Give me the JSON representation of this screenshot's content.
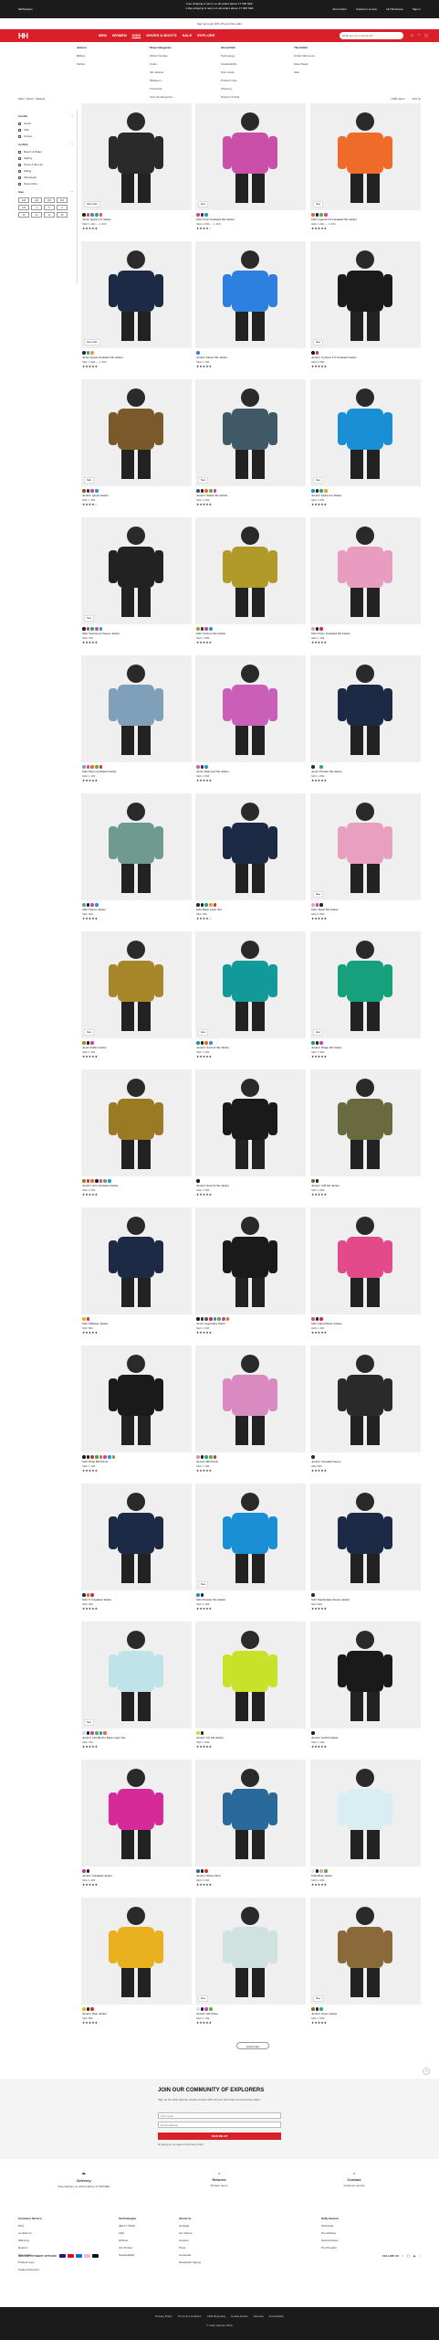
{
  "topbar": {
    "promo1": "Free shipping & return on all orders above 17 000 SEK",
    "promo2": "1-Day shipping & return on all orders above 17 000 SEK",
    "location": "SE/Sweden",
    "links": [
      "Store finder",
      "Customer service",
      "HH Workwear",
      "Sign in"
    ]
  },
  "promo_bar": "Sign up & get 10% off your first order",
  "nav": {
    "logo": "HH",
    "links": [
      "MEN",
      "WOMEN",
      "KIDS",
      "SHOES & BOOTS",
      "SALE",
      "EXPLORE"
    ],
    "active": "KIDS",
    "search_placeholder": "What are you looking for?",
    "icons": [
      "user-icon",
      "heart-icon",
      "bag-icon"
    ]
  },
  "mega": {
    "col1": [
      "Juniors",
      "Babies",
      "Mother"
    ],
    "col2": [
      "Shop Categories",
      "Winter Clothes",
      "Coats",
      "Ski Jackets",
      "Midlayers",
      "Snowsuits",
      "View all categories"
    ],
    "col3": [
      "About Kids",
      "Technology",
      "Sustainability",
      "Size Guide",
      "Product Care",
      "Shipping",
      "Support & FAQ"
    ],
    "col4": [
      "The Outlet",
      "Outlet Kids Items",
      "Shop Deals",
      "Sale"
    ]
  },
  "breadcrumb": "Kids / Junior / Jackets",
  "sort": {
    "count": "(108) Items",
    "label": "Sort by"
  },
  "filters": {
    "gender_title": "Gender",
    "genders": [
      "Junior",
      "Kids",
      "Unisex"
    ],
    "activity_title": "Activity",
    "activities": [
      "Beach & Water",
      "Sailing",
      "Snow & Ski Life",
      "Hiking",
      "Sleepwear",
      "Show More"
    ],
    "size_title": "Size",
    "sizes": [
      "128",
      "140",
      "152",
      "164",
      "176",
      "4",
      "6",
      "8",
      "10",
      "12",
      "14",
      "16"
    ]
  },
  "product_card": {
    "badge": "New"
  },
  "products": [
    {
      "name": "Junior Quest 2.0 Jacket",
      "price": "SEK 1 420 — 1 500",
      "stars": "★★★★★",
      "badge": "New Color",
      "img": "#2a2a2a",
      "sw": [
        "#222",
        "#c53",
        "#67c",
        "#2a8",
        "#d4a"
      ]
    },
    {
      "name": "Kids' Frost Insulated Ski Jacket",
      "price": "SEK 1 099 — 1 499",
      "stars": "★★★★☆",
      "badge": "New",
      "img": "#c94fa8",
      "sw": [
        "#c4a",
        "#333",
        "#29c"
      ]
    },
    {
      "name": "Kids' Legend 2.0 Insulated Ski Jacket",
      "price": "SEK 1 260 — 1 600",
      "stars": "★★★★★",
      "badge": "New",
      "img": "#ef6b2a",
      "sw": [
        "#e62",
        "#222",
        "#6a4",
        "#c4a"
      ]
    },
    {
      "name": "Junior Quest Insulated Ski Jacket",
      "price": "SEK 1 099 — 1 899",
      "stars": "★★★★★",
      "badge": "New Color",
      "img": "#1c2a45",
      "sw": [
        "#1c2a45",
        "#2a7",
        "#e93"
      ]
    },
    {
      "name": "Juniors' Alpine Ski Jacket",
      "price": "SEK 1 799",
      "stars": "★★★★★",
      "badge": "",
      "img": "#2d7fe0",
      "sw": [
        "#2d7fe0"
      ]
    },
    {
      "name": "Juniors' Cyclone 2.0 Insulated Jacket",
      "price": "SEK 2 999",
      "stars": "★★★★★",
      "badge": "New",
      "img": "#1a1a1a",
      "sw": [
        "#1a1a1a",
        "#c33",
        "#fff"
      ]
    },
    {
      "name": "Juniors' Quest Jacket",
      "price": "SEK 1 399",
      "stars": "★★★★☆",
      "badge": "Sale",
      "img": "#7a5a2a",
      "sw": [
        "#7a5a2a",
        "#333",
        "#c4a",
        "#29c"
      ]
    },
    {
      "name": "Juniors' Stellar Ski Jacket",
      "price": "SEK 1 699",
      "stars": "★★★★★",
      "badge": "New",
      "img": "#3f5a66",
      "sw": [
        "#3f5a66",
        "#222",
        "#e62",
        "#6a4",
        "#c4a"
      ]
    },
    {
      "name": "Juniors' Alpha 3.0 Jacket",
      "price": "SEK 2 499",
      "stars": "★★★★★",
      "badge": "New",
      "img": "#1a8fd6",
      "sw": [
        "#1a8fd6",
        "#222",
        "#2a7",
        "#e93"
      ]
    },
    {
      "name": "Kids' Vancouver Fleece Jacket",
      "price": "SEK 799",
      "stars": "★★★★★",
      "badge": "New",
      "img": "#222222",
      "sw": [
        "#222",
        "#c44",
        "#2a7",
        "#d4a",
        "#29c"
      ]
    },
    {
      "name": "Kids' Venture Ski Jacket",
      "price": "SEK 1 899",
      "stars": "★★★★★",
      "badge": "",
      "img": "#b29a2a",
      "sw": [
        "#b29a2a",
        "#333",
        "#c4a",
        "#29c"
      ]
    },
    {
      "name": "Kids' Flurry Insulated Ski Jacket",
      "price": "SEK 1 499",
      "stars": "★★★★★",
      "badge": "",
      "img": "#e89cc0",
      "sw": [
        "#e89cc0",
        "#222",
        "#c33"
      ]
    },
    {
      "name": "Kids' Moon Insulated Jacket",
      "price": "SEK 1 199",
      "stars": "★★★★★",
      "badge": "",
      "img": "#7fa0b8",
      "sw": [
        "#7fa0b8",
        "#c4a",
        "#e62",
        "#6a4",
        "#c33"
      ]
    },
    {
      "name": "Junior Diamond Ski Jacket",
      "price": "SEK 2 099",
      "stars": "★★★★★",
      "badge": "",
      "img": "#c95fb8",
      "sw": [
        "#c95fb8",
        "#333",
        "#29c"
      ]
    },
    {
      "name": "Junior Powder Ski Jacket",
      "price": "SEK 1 699",
      "stars": "★★★★★",
      "badge": "",
      "img": "#1c2a45",
      "sw": [
        "#1c2a45",
        "#fff",
        "#2a7"
      ]
    },
    {
      "name": "Kids' Fleece Jacket",
      "price": "SEK 699",
      "stars": "★★★★★",
      "badge": "",
      "img": "#6f9a90",
      "sw": [
        "#6f9a90",
        "#222",
        "#c4a",
        "#29c"
      ]
    },
    {
      "name": "Kids' Base Layer Set",
      "price": "SEK 599",
      "stars": "★★★★☆",
      "badge": "",
      "img": "#1c2a45",
      "sw": [
        "#1c2a45",
        "#222",
        "#2a7",
        "#e93",
        "#c33"
      ]
    },
    {
      "name": "Kids' Jewel Ski Jacket",
      "price": "SEK 1 899",
      "stars": "★★★★★",
      "badge": "New",
      "img": "#e8a0c0",
      "sw": [
        "#e8a0c0",
        "#c4a",
        "#222"
      ]
    },
    {
      "name": "Junior Puffer Jacket",
      "price": "SEK 1 499",
      "stars": "★★★★★",
      "badge": "New",
      "img": "#a8862a",
      "sw": [
        "#a8862a",
        "#222",
        "#c4a"
      ]
    },
    {
      "name": "Juniors' Summit Ski Jacket",
      "price": "SEK 1 999",
      "stars": "★★★★★",
      "badge": "New",
      "img": "#129a9a",
      "sw": [
        "#129a9a",
        "#222",
        "#e62",
        "#29c"
      ]
    },
    {
      "name": "Juniors' Ridge Ski Jacket",
      "price": "SEK 1 999",
      "stars": "★★★★★",
      "badge": "New",
      "img": "#16a07c",
      "sw": [
        "#16a07c",
        "#222",
        "#c4a"
      ]
    },
    {
      "name": "Juniors' Icon Insulated Jacket",
      "price": "SEK 2 299",
      "stars": "★★★★★",
      "badge": "",
      "img": "#9a7a22",
      "sw": [
        "#9a7a22",
        "#c33",
        "#e62",
        "#222",
        "#c4a",
        "#6a4",
        "#29c"
      ]
    },
    {
      "name": "Juniors' Summit Ski Jacket",
      "price": "SEK 1 999",
      "stars": "★★★★★",
      "badge": "",
      "img": "#1a1a1a",
      "sw": [
        "#1a1a1a"
      ]
    },
    {
      "name": "Juniors' Cliff Ski Jacket",
      "price": "SEK 1 899",
      "stars": "★★★★★",
      "badge": "",
      "img": "#6a6a40",
      "sw": [
        "#6a6a40",
        "#222"
      ]
    },
    {
      "name": "Kids' Midlayer Jacket",
      "price": "SEK 899",
      "stars": "★★★★★",
      "badge": "",
      "img": "#1c2a45",
      "sw": [
        "#e9b020",
        "#c33"
      ]
    },
    {
      "name": "Junior Legendary Pants",
      "price": "SEK 1 299",
      "stars": "★★★★★",
      "badge": "",
      "img": "#1a1a1a",
      "sw": [
        "#1a1a1a",
        "#333",
        "#555",
        "#c33",
        "#29c",
        "#6a4",
        "#c4a",
        "#e62"
      ]
    },
    {
      "name": "Kids' Isfjord Down Jacket",
      "price": "SEK 1 299",
      "stars": "★★★★★",
      "badge": "",
      "img": "#e24a8a",
      "sw": [
        "#e24a8a",
        "#222",
        "#c33"
      ]
    },
    {
      "name": "Kids' Rider Bib Pants",
      "price": "SEK 1 199",
      "stars": "★★★★★",
      "badge": "",
      "img": "#1a1a1a",
      "sw": [
        "#1a1a1a",
        "#222",
        "#c33",
        "#2a7",
        "#e62",
        "#c4a",
        "#29c",
        "#6a4"
      ]
    },
    {
      "name": "Juniors' Bib Pants",
      "price": "SEK 1 199",
      "stars": "★★★★★",
      "badge": "",
      "img": "#d98ac0",
      "sw": [
        "#d98ac0",
        "#222",
        "#2a7",
        "#6a4",
        "#c33"
      ]
    },
    {
      "name": "Juniors' Versatile Fleece",
      "price": "SEK 699",
      "stars": "★★★★★",
      "badge": "",
      "img": "#2a2a2a",
      "sw": [
        "#2a2a2a"
      ]
    },
    {
      "name": "Kids' K Insulated Jacket",
      "price": "SEK 999",
      "stars": "★★★★★",
      "badge": "",
      "img": "#1c2a45",
      "sw": [
        "#1c2a45",
        "#e62",
        "#c33"
      ]
    },
    {
      "name": "Kids' Powder Ski Jacket",
      "price": "SEK 1 499",
      "stars": "★★★★★",
      "badge": "New",
      "img": "#1a8fd6",
      "sw": [
        "#1a8fd6",
        "#222"
      ]
    },
    {
      "name": "Kids' Daybreaker Fleece Jacket",
      "price": "SEK 699",
      "stars": "★★★★★",
      "badge": "",
      "img": "#1c2a45",
      "sw": [
        "#1c2a45"
      ]
    },
    {
      "name": "Juniors' Lifa Merino Base Layer Set",
      "price": "SEK 799",
      "stars": "★★★★★",
      "badge": "New",
      "img": "#bfe3e8",
      "sw": [
        "#bfe3e8",
        "#222",
        "#c4a",
        "#6a4",
        "#29c",
        "#e62"
      ]
    },
    {
      "name": "Juniors' Fly Ski Jacket",
      "price": "SEK 1 599",
      "stars": "★★★★★",
      "badge": "",
      "img": "#c8e22a",
      "sw": [
        "#c8e22a",
        "#222"
      ]
    },
    {
      "name": "Juniors' Hybrid Jacket",
      "price": "SEK 1 299",
      "stars": "★★★★★",
      "badge": "",
      "img": "#1a1a1a",
      "sw": [
        "#1a1a1a"
      ]
    },
    {
      "name": "Juniors' Insulated Jacket",
      "price": "SEK 1 499",
      "stars": "★★★★★",
      "badge": "",
      "img": "#d62a9a",
      "sw": [
        "#d62a9a",
        "#222"
      ]
    },
    {
      "name": "Juniors' Winter Boot",
      "price": "SEK 1 099",
      "stars": "★★★★★",
      "badge": "",
      "img": "#2a6a9a",
      "sw": [
        "#2a6a9a",
        "#222",
        "#c33"
      ]
    },
    {
      "name": "Little Bear Jacket",
      "price": "SEK 1 399",
      "stars": "★★★★★",
      "badge": "",
      "img": "#d8eef2",
      "sw": [
        "#d8eef2",
        "#222",
        "#e89cc0",
        "#6a4"
      ]
    },
    {
      "name": "Juniors' Rain Jacket",
      "price": "SEK 899",
      "stars": "★★★★★",
      "badge": "",
      "img": "#e9b020",
      "sw": [
        "#e9b020",
        "#222",
        "#c33"
      ]
    },
    {
      "name": "Juniors' Ski Pants",
      "price": "SEK 1 199",
      "stars": "★★★★★",
      "badge": "New",
      "img": "#cfe2df",
      "sw": [
        "#cfe2df",
        "#222",
        "#c4a",
        "#6a4"
      ]
    },
    {
      "name": "Juniors' Down Jacket",
      "price": "SEK 1 699",
      "stars": "★★★★★",
      "badge": "New",
      "img": "#8a6a3a",
      "sw": [
        "#8a6a3a",
        "#222",
        "#2a7"
      ]
    }
  ],
  "load_more": "Load more",
  "signup": {
    "title": "JOIN OUR COMMUNITY OF EXPLORERS",
    "text": "Sign up for Helly Hansen emails and get 10% off your first order and exclusive offers",
    "name_placeholder": "First name",
    "email_placeholder": "Email address",
    "button": "SIGN ME UP",
    "consent": "By signing up you agree to the Privacy Policy"
  },
  "usps": [
    {
      "title": "Delivery",
      "text": "Free delivery on orders above 17 000 SEK"
    },
    {
      "title": "Returns",
      "text": "30 days return"
    },
    {
      "title": "Contact",
      "text": "Customer service"
    }
  ],
  "footer": {
    "cols": [
      {
        "title": "Customer Service",
        "items": [
          "FAQ",
          "Contact Us",
          "Warranty",
          "Returns",
          "Size Guide",
          "Product Care",
          "Student Discount"
        ]
      },
      {
        "title": "Technologies",
        "items": [
          "HELLY TECH",
          "LIFA",
          "H2Flow",
          "Life Pocket",
          "Sustainability"
        ]
      },
      {
        "title": "About Us",
        "items": [
          "Heritage",
          "Our Stores",
          "Careers",
          "Press",
          "Corporate",
          "Newsletter Signup"
        ]
      },
      {
        "title": "Helly Hansen",
        "items": [
          "Workwear",
          "Pro Athletes",
          "Sponsorships",
          "Pro Program"
        ]
      }
    ]
  },
  "payment_label": "SECURE PAYMENT OPTIONS",
  "payments": [
    "#1a1f71",
    "#eb001b",
    "#0070e0",
    "#ffb3c7",
    "#111111"
  ],
  "social_label": "FOLLOW US",
  "legal": {
    "links": [
      "Privacy Policy",
      "Terms & Conditions",
      "CSR Reporting",
      "Cookie Notice",
      "Sitemap",
      "Accessibility"
    ],
    "copyright": "© Helly Hansen 2024"
  }
}
